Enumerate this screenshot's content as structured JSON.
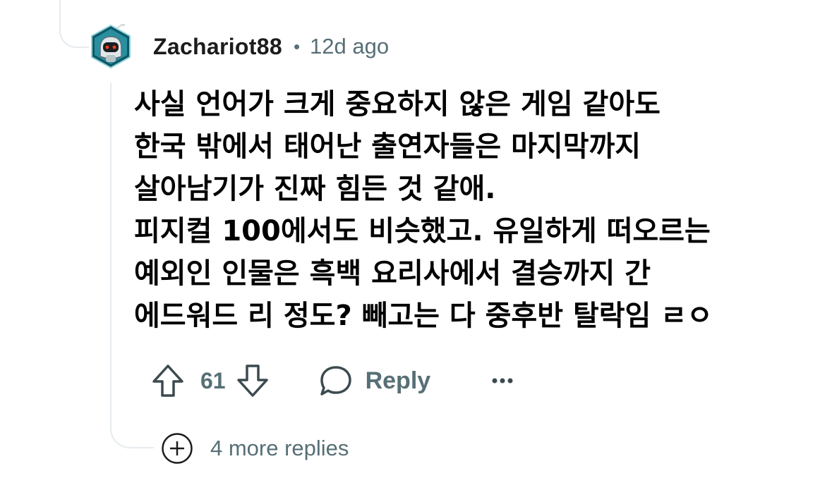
{
  "comment": {
    "username": "Zachariot88",
    "separator": "•",
    "timestamp": "12d ago",
    "avatar_icon": "robot-avatar-icon",
    "body_lines": [
      "사실 언어가 크게 중요하지 않은 게임 같아도",
      "한국 밖에서 태어난 출연자들은 마지막까지",
      "살아남기가 진짜 힘든 것 같애.",
      "피지컬 100에서도 비슷했고. 유일하게 떠오르는",
      "예외인 인물은 흑백 요리사에서 결승까지 간",
      "에드워드 리 정도? 빼고는 다 중후반 탈락임 ㄹㅇ"
    ]
  },
  "actions": {
    "upvote_icon": "upvote-arrow-icon",
    "vote_count": "61",
    "downvote_icon": "downvote-arrow-icon",
    "reply_icon": "speech-bubble-icon",
    "reply_label": "Reply",
    "more_icon": "ellipsis-icon"
  },
  "thread": {
    "more_replies_icon": "plus-circle-icon",
    "more_replies_label": "4 more replies"
  },
  "colors": {
    "text_primary": "#000000",
    "text_muted": "#576f76",
    "thread_line": "#e5ebee",
    "avatar_teal": "#2a8fa0"
  }
}
